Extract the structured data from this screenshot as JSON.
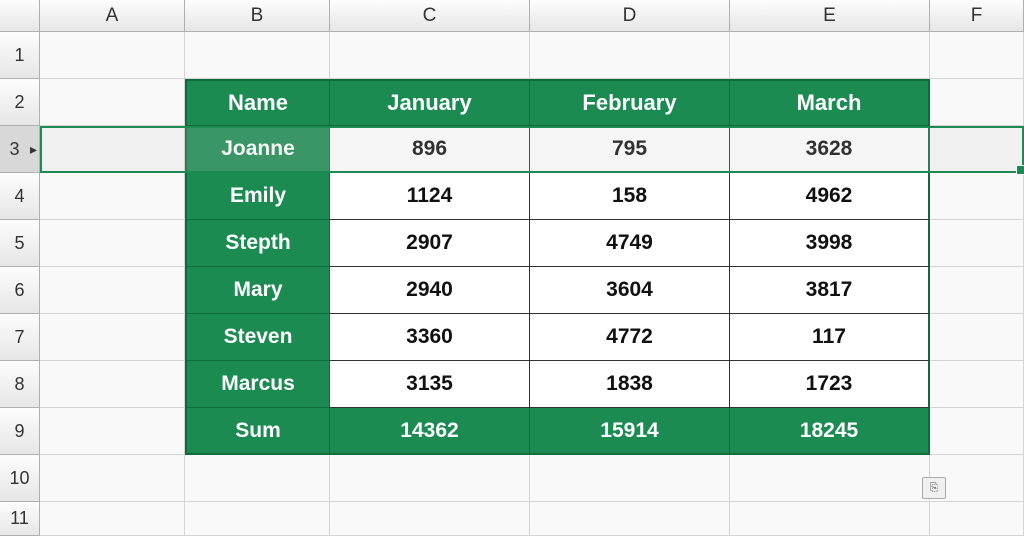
{
  "columns": [
    "A",
    "B",
    "C",
    "D",
    "E",
    "F"
  ],
  "rows": [
    "1",
    "2",
    "3",
    "4",
    "5",
    "6",
    "7",
    "8",
    "9",
    "10",
    "11"
  ],
  "selected_row": 3,
  "table": {
    "headers": [
      "Name",
      "January",
      "February",
      "March"
    ],
    "names": [
      "Joanne",
      "Emily",
      "Stepth",
      "Mary",
      "Steven",
      "Marcus"
    ],
    "data": [
      {
        "jan": 896,
        "feb": 795,
        "mar": 3628
      },
      {
        "jan": 1124,
        "feb": 158,
        "mar": 4962
      },
      {
        "jan": 2907,
        "feb": 4749,
        "mar": 3998
      },
      {
        "jan": 2940,
        "feb": 3604,
        "mar": 3817
      },
      {
        "jan": 3360,
        "feb": 4772,
        "mar": 117
      },
      {
        "jan": 3135,
        "feb": 1838,
        "mar": 1723
      }
    ],
    "sum": {
      "label": "Sum",
      "jan": 14362,
      "feb": 15914,
      "mar": 18245
    }
  },
  "chart_data": {
    "type": "table",
    "columns": [
      "Name",
      "January",
      "February",
      "March"
    ],
    "rows": [
      [
        "Joanne",
        896,
        795,
        3628
      ],
      [
        "Emily",
        1124,
        158,
        4962
      ],
      [
        "Stepth",
        2907,
        4749,
        3998
      ],
      [
        "Mary",
        2940,
        3604,
        3817
      ],
      [
        "Steven",
        3360,
        4772,
        117
      ],
      [
        "Marcus",
        3135,
        1838,
        1723
      ],
      [
        "Sum",
        14362,
        15914,
        18245
      ]
    ]
  }
}
